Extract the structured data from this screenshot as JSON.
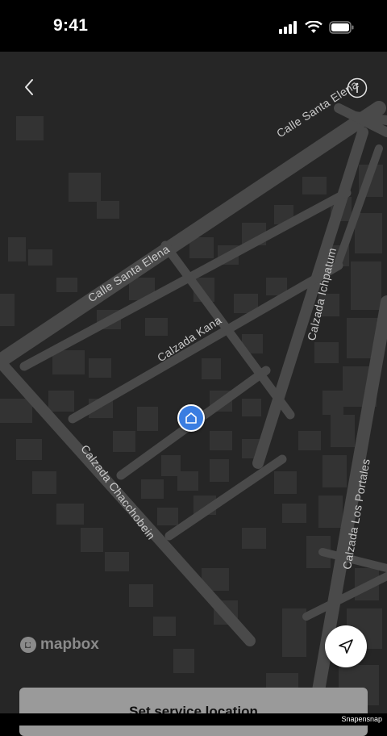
{
  "status_bar": {
    "time": "9:41"
  },
  "nav": {
    "back_icon": "chevron-left-icon",
    "info_icon": "info-icon"
  },
  "map": {
    "streets": [
      {
        "id": "calle-santa-elena-north",
        "label": "Calle Santa Elena"
      },
      {
        "id": "calle-santa-elena-west",
        "label": "Calle Santa Elena"
      },
      {
        "id": "calzada-kana",
        "label": "Calzada Kana"
      },
      {
        "id": "calzada-ichpatum",
        "label": "Calzada Ichpatum"
      },
      {
        "id": "calzada-chacchobein",
        "label": "Calzada Chacchobein"
      },
      {
        "id": "calzada-los-portales",
        "label": "Calzada Los Portales"
      }
    ],
    "marker_icon": "home-icon",
    "attribution": "mapbox",
    "colors": {
      "background": "#262626",
      "road": "#4a4a4a",
      "building": "#333333",
      "marker": "#3a7de1"
    }
  },
  "controls": {
    "locate_icon": "navigation-arrow-icon"
  },
  "action": {
    "label": "Set service location"
  },
  "watermark": "Snapensnap"
}
